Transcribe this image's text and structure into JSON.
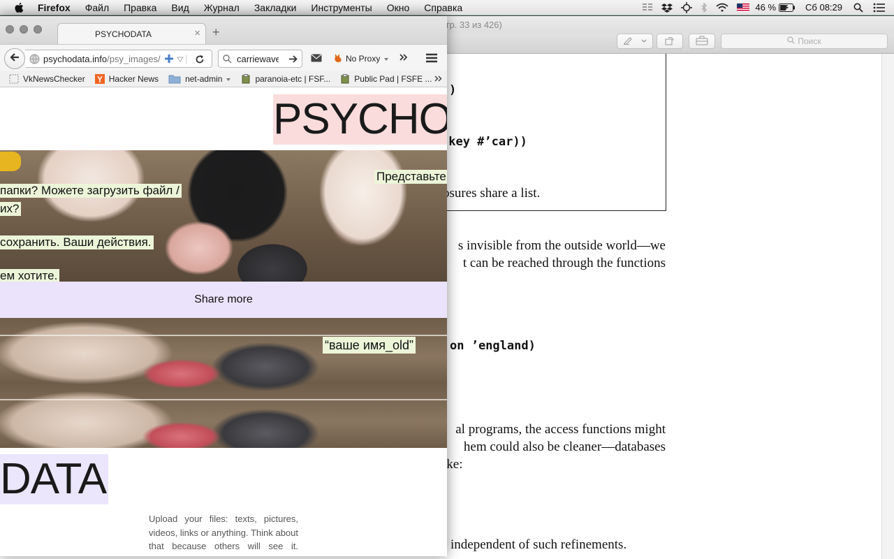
{
  "menubar": {
    "app_name": "Firefox",
    "items": [
      "Файл",
      "Правка",
      "Вид",
      "Журнал",
      "Закладки",
      "Инструменты",
      "Окно",
      "Справка"
    ],
    "battery_percent": "46 %",
    "clock": "Сб 08:29"
  },
  "viewer": {
    "title_fragment": "стр. 33 из 426)",
    "search_placeholder": "Поиск",
    "lines": {
      "code1": ")",
      "code2": ":key #’car))",
      "text1": "osures share a list.",
      "text2": "s invisible from the outside world—we",
      "text3": "t can be reached through the functions",
      "code3": "on ’england)",
      "text4": "al programs, the access functions might",
      "text5": "hem could also be cleaner—databases",
      "text6": "ike:",
      "text7": "independent of such refinements."
    }
  },
  "browser": {
    "tab_title": "PSYCHODATA",
    "url_host": "psychodata.info",
    "url_path": "/psy_images/sh",
    "search_value": "carriewave va",
    "proxy_label": "No Proxy",
    "bookmarks": [
      "VkNewsChecker",
      "Hacker News",
      "net-admin",
      "paranoia-etc | FSF...",
      "Public Pad | FSFE ..."
    ]
  },
  "page": {
    "logo_top": "PSYCHO",
    "logo_bottom": "DATA",
    "overlay1": "Представьте",
    "overlay2": "папки? Можете загрузить  файл /",
    "overlay3": "их?",
    "overlay4": "сохранить. Ваши действия.",
    "overlay5": "ем хотите.",
    "share_button": "Share more",
    "quote": "“ваше имя_old”",
    "intro_text": "Upload your files: texts, pictures, videos, links or anything. Think about that because others will see it. Submit your data and get"
  },
  "colors": {
    "logo_top_bg": "#fadcdc",
    "logo_bottom_bg": "#ebe6fb",
    "share_bg": "#ebe3fb",
    "overlay_bg": "#ecf5d8"
  }
}
